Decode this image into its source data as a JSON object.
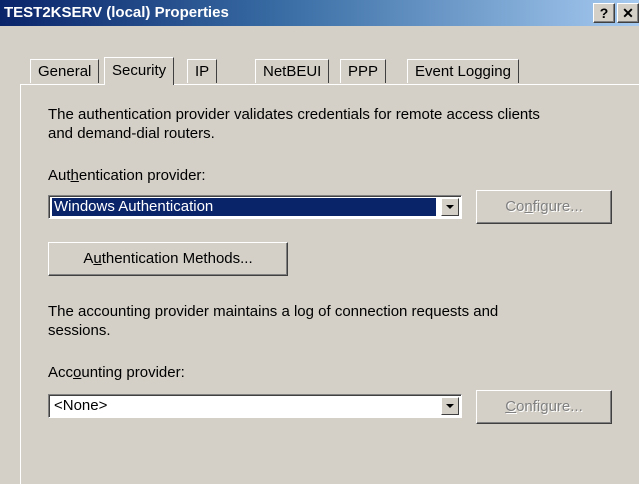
{
  "window": {
    "title": "TEST2KSERV (local) Properties",
    "help_glyph": "?",
    "close_glyph": "✕"
  },
  "tabs": [
    {
      "label": "General"
    },
    {
      "label": "Security",
      "active": true
    },
    {
      "label": "IP"
    },
    {
      "label": "NetBEUI"
    },
    {
      "label": "PPP"
    },
    {
      "label": "Event Logging"
    }
  ],
  "security": {
    "auth_description_line1": "The authentication provider validates credentials for remote access clients",
    "auth_description_line2": "and demand-dial routers.",
    "auth_provider_label_pre": "Aut",
    "auth_provider_label_key": "h",
    "auth_provider_label_post": "entication provider:",
    "auth_provider_value": "Windows Authentication",
    "auth_configure_pre": "Co",
    "auth_configure_key": "n",
    "auth_configure_post": "figure...",
    "auth_methods_pre": "A",
    "auth_methods_key": "u",
    "auth_methods_post": "thentication Methods...",
    "acct_description_line1": "The accounting provider maintains a log of connection requests and",
    "acct_description_line2": "sessions.",
    "acct_provider_label_pre": "Acc",
    "acct_provider_label_key": "o",
    "acct_provider_label_post": "unting provider:",
    "acct_provider_value": "<None>",
    "acct_configure_pre": "",
    "acct_configure_key": "C",
    "acct_configure_post": "onfigure..."
  },
  "colors": {
    "face": "#d4d0c8",
    "title_start": "#0a246a",
    "title_end": "#a6caf0",
    "selection": "#0a246a"
  }
}
